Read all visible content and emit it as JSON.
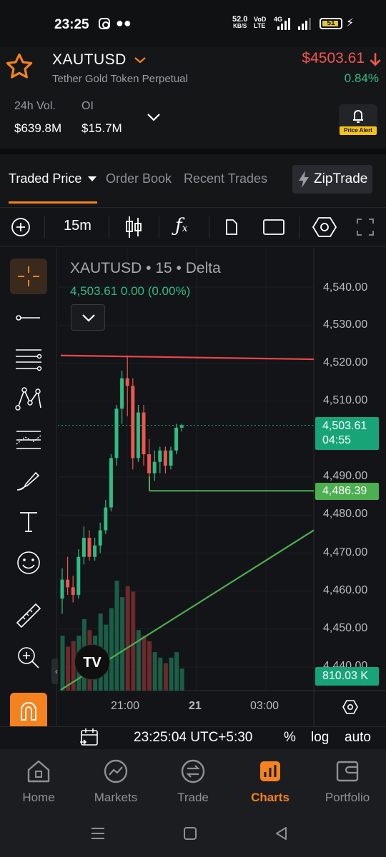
{
  "status_bar": {
    "time": "23:25",
    "net_speed_top": "52.0",
    "net_speed_unit": "KB/S",
    "volte_top": "VoD",
    "volte_bottom": "LTE",
    "network": "4G",
    "battery": "51"
  },
  "header": {
    "symbol": "XAUTUSD",
    "subtitle": "Tether Gold Token Perpetual",
    "price": "$4503.61",
    "change": "0.84%",
    "vol_label": "24h Vol.",
    "vol_value": "$639.8M",
    "oi_label": "OI",
    "oi_value": "$15.7M",
    "price_alert": "Price Alert"
  },
  "tabs": {
    "items": [
      "Traded Price",
      "Order Book",
      "Recent Trades"
    ],
    "active": "Traded Price",
    "ziptrade": "ZipTrade"
  },
  "toolbar": {
    "interval": "15m"
  },
  "chart": {
    "title": "XAUTUSD • 15 • Delta",
    "ohlc": "4,503.61  0.00 (0.00%)",
    "price_labels": [
      "4,540.00",
      "4,530.00",
      "4,520.00",
      "4,510.00",
      "4,490.00",
      "4,480.00",
      "4,470.00",
      "4,460.00",
      "4,450.00",
      "4,440.00"
    ],
    "current_price": "4,503.61",
    "countdown": "04:55",
    "hline_price": "4,486.39",
    "volume": "810.03 K",
    "time_labels": [
      "21:00",
      "21",
      "03:00"
    ],
    "tv_logo": "TV"
  },
  "chart_data": {
    "type": "candlestick",
    "title": "XAUTUSD • 15 • Delta",
    "ylim": [
      4440,
      4543
    ],
    "y_ticks": [
      4440,
      4450,
      4460,
      4470,
      4480,
      4490,
      4510,
      4520,
      4530,
      4540
    ],
    "x_tick_labels": [
      "21:00",
      "21",
      "03:00"
    ],
    "candles": [
      {
        "o": 4458,
        "h": 4466,
        "l": 4454,
        "c": 4463
      },
      {
        "o": 4463,
        "h": 4469,
        "l": 4459,
        "c": 4461
      },
      {
        "o": 4461,
        "h": 4464,
        "l": 4457,
        "c": 4459
      },
      {
        "o": 4459,
        "h": 4471,
        "l": 4458,
        "c": 4469
      },
      {
        "o": 4469,
        "h": 4477,
        "l": 4467,
        "c": 4474
      },
      {
        "o": 4474,
        "h": 4476,
        "l": 4468,
        "c": 4469
      },
      {
        "o": 4469,
        "h": 4474,
        "l": 4468,
        "c": 4472
      },
      {
        "o": 4472,
        "h": 4478,
        "l": 4470,
        "c": 4476
      },
      {
        "o": 4476,
        "h": 4484,
        "l": 4475,
        "c": 4482
      },
      {
        "o": 4482,
        "h": 4496,
        "l": 4481,
        "c": 4495
      },
      {
        "o": 4495,
        "h": 4509,
        "l": 4493,
        "c": 4508
      },
      {
        "o": 4508,
        "h": 4518,
        "l": 4504,
        "c": 4516
      },
      {
        "o": 4516,
        "h": 4522,
        "l": 4506,
        "c": 4514
      },
      {
        "o": 4514,
        "h": 4516,
        "l": 4492,
        "c": 4495
      },
      {
        "o": 4495,
        "h": 4509,
        "l": 4494,
        "c": 4507
      },
      {
        "o": 4507,
        "h": 4509,
        "l": 4493,
        "c": 4496
      },
      {
        "o": 4496,
        "h": 4500,
        "l": 4490,
        "c": 4491
      },
      {
        "o": 4491,
        "h": 4497,
        "l": 4489,
        "c": 4494
      },
      {
        "o": 4494,
        "h": 4498,
        "l": 4491,
        "c": 4497
      },
      {
        "o": 4497,
        "h": 4498,
        "l": 4491,
        "c": 4493
      },
      {
        "o": 4493,
        "h": 4498,
        "l": 4492,
        "c": 4497
      },
      {
        "o": 4497,
        "h": 4504,
        "l": 4496,
        "c": 4503
      },
      {
        "o": 4503,
        "h": 4504,
        "l": 4502,
        "c": 4503.61
      }
    ],
    "volumes": [
      0.5,
      0.4,
      0.45,
      0.5,
      0.65,
      0.55,
      0.5,
      0.7,
      0.6,
      0.75,
      1.0,
      0.85,
      0.95,
      0.9,
      0.55,
      0.5,
      0.45,
      0.35,
      0.3,
      0.25,
      0.3,
      0.35,
      0.2
    ],
    "horizontal_lines": [
      {
        "price": 4486.39,
        "color": "#4caf50"
      }
    ],
    "trend_lines": [
      {
        "from_price": 4522,
        "to_price": 4521,
        "color": "#f0454c"
      },
      {
        "from_price": 4434,
        "to_price": 4476,
        "color": "#4caf50"
      }
    ],
    "current_price": 4503.61
  },
  "footer": {
    "time": "23:25:04 UTC+5:30",
    "percent": "%",
    "log": "log",
    "auto": "auto"
  },
  "nav": {
    "items": [
      "Home",
      "Markets",
      "Trade",
      "Charts",
      "Portfolio"
    ],
    "active": "Charts"
  },
  "colors": {
    "accent": "#f5821f",
    "up": "#2ebd85",
    "down": "#f0554f",
    "hline": "#4caf50",
    "background": "#131417"
  }
}
